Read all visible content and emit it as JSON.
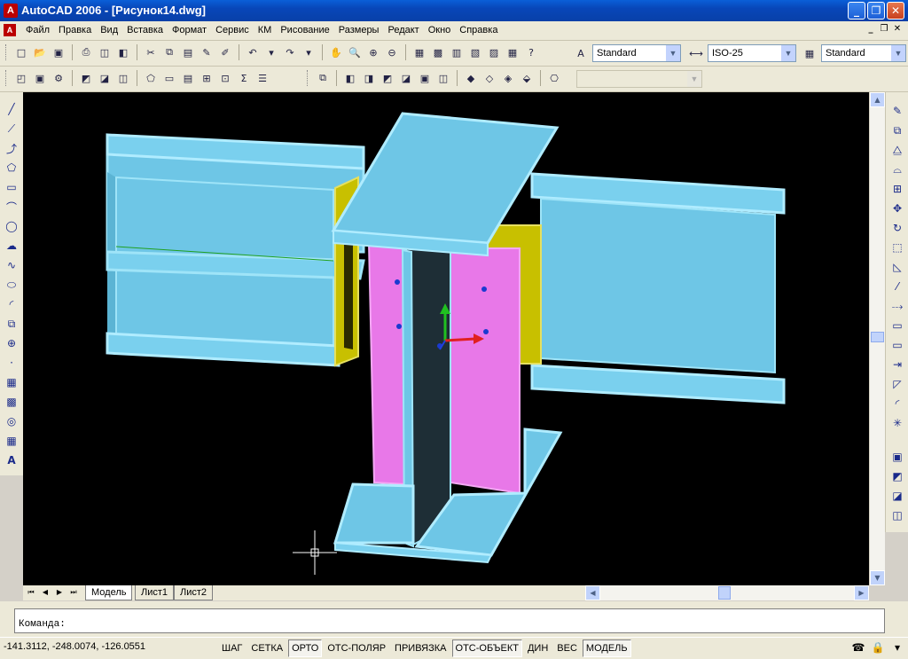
{
  "window": {
    "title": "AutoCAD 2006 - [Рисунок14.dwg]",
    "app_icon_glyph": "A"
  },
  "menu": {
    "doc_icon_glyph": "A",
    "items": [
      "Файл",
      "Правка",
      "Вид",
      "Вставка",
      "Формат",
      "Сервис",
      "КМ",
      "Рисование",
      "Размеры",
      "Редакт",
      "Окно",
      "Справка"
    ]
  },
  "styles_toolbar": {
    "text_style": "Standard",
    "dim_style": "ISO-25",
    "table_style": "Standard"
  },
  "view_toolbar": {
    "named_view": ""
  },
  "layout_tabs": [
    "Модель",
    "Лист1",
    "Лист2"
  ],
  "command": {
    "prompt": "Команда:"
  },
  "status": {
    "coordinates": "-141.3112, -248.0074, -126.0551",
    "toggles": [
      {
        "label": "ШАГ",
        "on": false
      },
      {
        "label": "СЕТКА",
        "on": false
      },
      {
        "label": "ОРТО",
        "on": true
      },
      {
        "label": "ОТС-ПОЛЯР",
        "on": false
      },
      {
        "label": "ПРИВЯЗКА",
        "on": false
      },
      {
        "label": "ОТС-ОБЪЕКТ",
        "on": true
      },
      {
        "label": "ДИН",
        "on": false
      },
      {
        "label": "ВЕС",
        "on": false
      },
      {
        "label": "МОДЕЛЬ",
        "on": true
      }
    ]
  },
  "colors": {
    "canvas": "#000000",
    "beam": "#6ec6e6",
    "beam_edge": "#9fe4f8",
    "plate_yellow": "#c8c000",
    "plate_magenta": "#e878e8",
    "web_dark": "#1e2e36",
    "ucs_x": "#e02020",
    "ucs_y": "#20c020"
  },
  "icons": {
    "standard": [
      "new-icon",
      "open-icon",
      "save-icon",
      "print-icon",
      "plot-preview-icon",
      "publish-icon",
      "cut-icon",
      "copy-icon",
      "paste-icon",
      "match-properties-icon",
      "block-editor-icon",
      "undo-icon",
      "redo-icon",
      "pan-icon",
      "zoom-realtime-icon",
      "zoom-window-icon",
      "zoom-previous-icon",
      "properties-icon",
      "design-center-icon",
      "tool-palettes-icon",
      "sheet-set-icon",
      "markup-icon",
      "calculator-icon",
      "help-icon"
    ]
  }
}
